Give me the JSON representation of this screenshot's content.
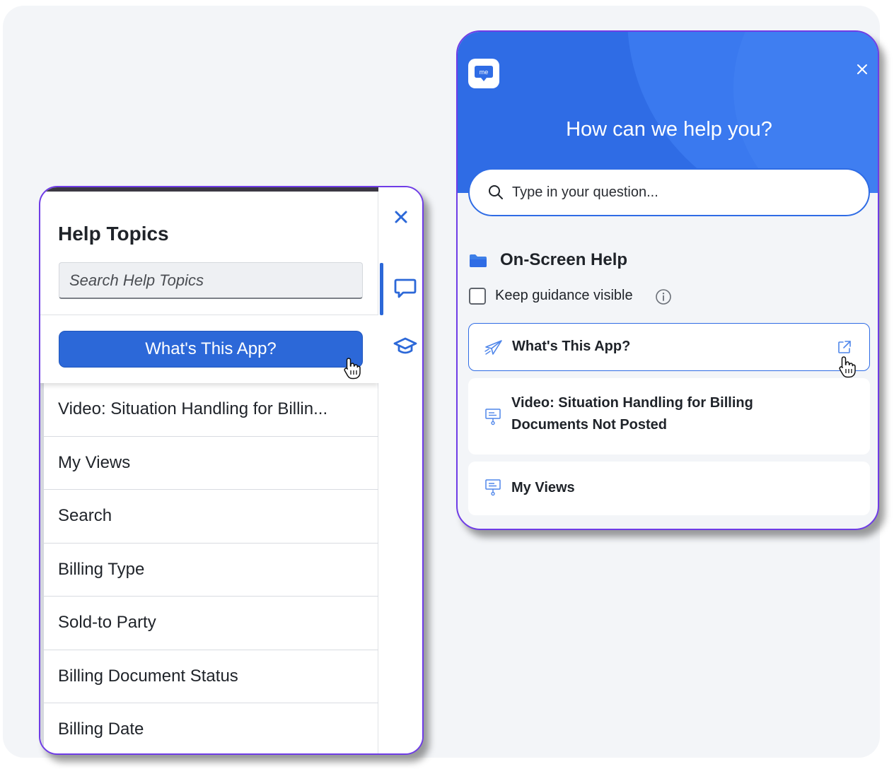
{
  "left_panel": {
    "title": "Help Topics",
    "search_placeholder": "Search Help Topics",
    "whats_this_app": "What's This App?",
    "items": [
      {
        "label": "Video: Situation Handling for Billin..."
      },
      {
        "label": "My Views"
      },
      {
        "label": "Search"
      },
      {
        "label": "Billing Type"
      },
      {
        "label": "Sold-to Party"
      },
      {
        "label": "Billing Document Status"
      },
      {
        "label": "Billing Date"
      }
    ],
    "icons": {
      "close": "close-icon",
      "chat": "chat-bubble-icon",
      "learning": "graduation-cap-icon"
    }
  },
  "right_panel": {
    "logo_text": "me",
    "heading": "How can we help you?",
    "search_placeholder": "Type in your question...",
    "section_title": "On-Screen Help",
    "keep_guidance_label": "Keep guidance visible",
    "cards": [
      {
        "line1": "What's This App?",
        "line2": "",
        "icon": "paper-plane-icon",
        "active": true
      },
      {
        "line1": "Video: Situation Handling for Billing",
        "line2": "Documents Not Posted",
        "icon": "presentation-icon",
        "active": false
      },
      {
        "line1": "My Views",
        "line2": "",
        "icon": "presentation-icon",
        "active": false
      }
    ]
  },
  "colors": {
    "brand_blue": "#2f6ce5",
    "frame_purple": "#6f3ce6",
    "text": "#1f2329"
  }
}
